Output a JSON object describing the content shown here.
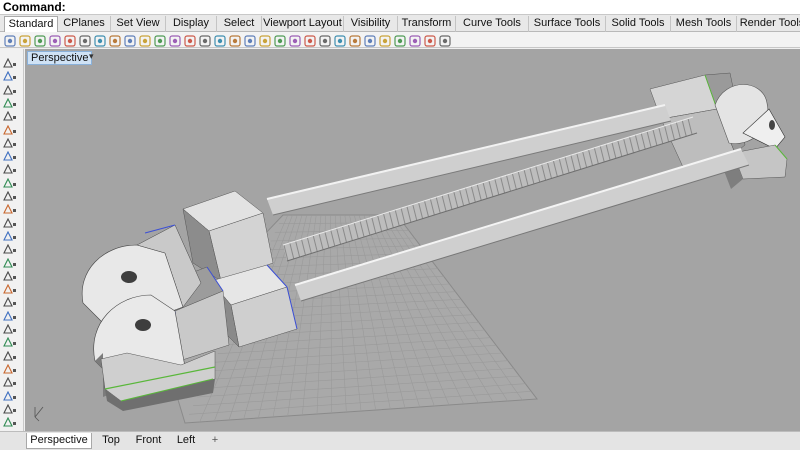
{
  "command": {
    "label": "Command:"
  },
  "tabs": [
    {
      "label": "Standard",
      "active": true
    },
    {
      "label": "CPlanes"
    },
    {
      "label": "Set View"
    },
    {
      "label": "Display"
    },
    {
      "label": "Select"
    },
    {
      "label": "Viewport Layout"
    },
    {
      "label": "Visibility"
    },
    {
      "label": "Transform"
    },
    {
      "label": "Curve Tools"
    },
    {
      "label": "Surface Tools"
    },
    {
      "label": "Solid Tools"
    },
    {
      "label": "Mesh Tools"
    },
    {
      "label": "Render Tools"
    }
  ],
  "toolbar_icons": [
    "new-file-icon",
    "open-file-icon",
    "save-icon",
    "print-icon",
    "import-icon",
    "cut-icon",
    "copy-icon",
    "paste-icon",
    "undo-icon",
    "redo-icon",
    "pan-icon",
    "rotate-view-icon",
    "zoom-window-icon",
    "zoom-extents-icon",
    "zoom-selected-icon",
    "zoom-extents-all-icon",
    "grid-icon",
    "select-points-icon",
    "cplane-icon",
    "named-views-icon",
    "lightbulb-icon",
    "layer-icon",
    "properties-icon",
    "material-icon",
    "wireframe-icon",
    "shaded-icon",
    "rendered-icon",
    "render-icon",
    "options-icon",
    "help-icon"
  ],
  "left_toolbar_icons": [
    "select-icon",
    "point-icon",
    "polyline-icon",
    "curve-icon",
    "circle-icon",
    "arc-icon",
    "ellipse-icon",
    "polygon-icon",
    "rectangle-icon",
    "freeform-icon",
    "fillet-icon",
    "offset-icon",
    "surface-icon",
    "extrude-icon",
    "box-icon",
    "sphere-icon",
    "cylinder-icon",
    "mesh-icon",
    "boolean-icon",
    "split-icon",
    "transform-icon",
    "array-icon",
    "trim-icon",
    "join-icon",
    "explode-icon",
    "text-icon",
    "dimension-icon",
    "group-icon"
  ],
  "viewport": {
    "title": "Perspective",
    "caret": "▾"
  },
  "bottom_tabs": [
    {
      "label": "Perspective",
      "active": true
    },
    {
      "label": "Top"
    },
    {
      "label": "Front"
    },
    {
      "label": "Left"
    },
    {
      "label": "+"
    }
  ],
  "colors": {
    "viewport_bg": "#a4a4a4",
    "grid_line": "#8d8d8d",
    "part_light": "#e9e9e9",
    "part_mid": "#c9c9c9",
    "part_dark": "#7c7c7c",
    "edge_green": "#59b73a",
    "edge_blue": "#3b4fd6",
    "active_title_bg": "#cfe2f5"
  }
}
